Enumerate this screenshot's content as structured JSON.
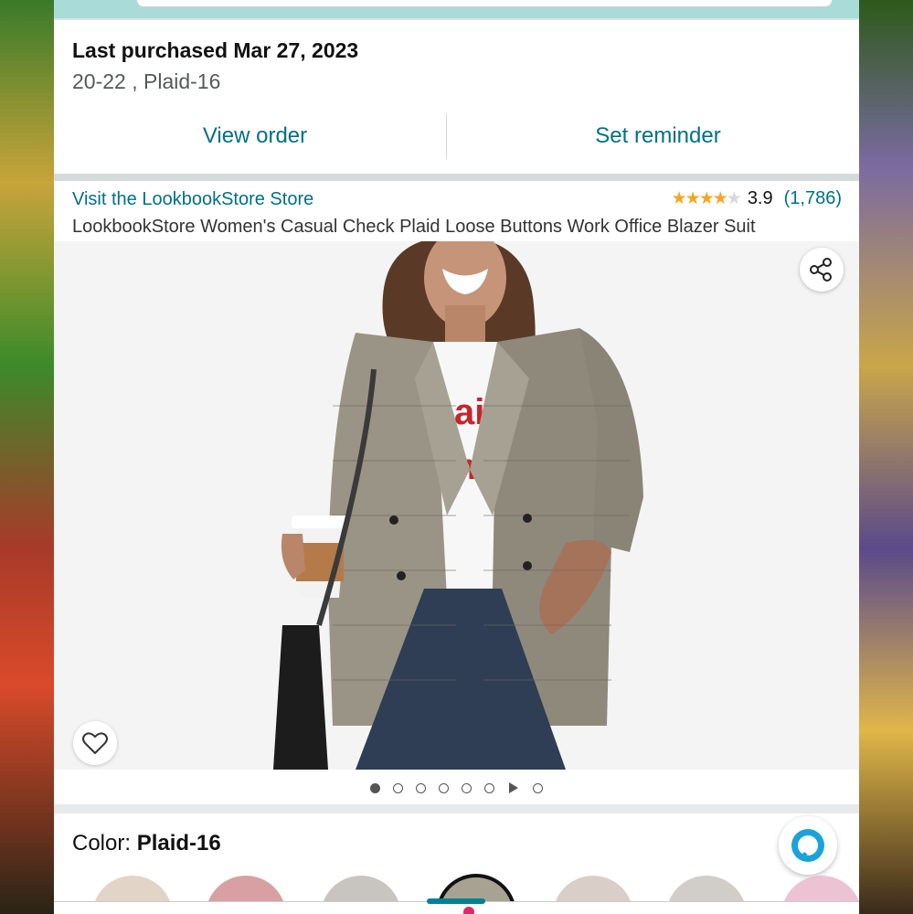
{
  "purchase": {
    "title": "Last purchased Mar 27, 2023",
    "variant": "20-22 , Plaid-16"
  },
  "actions": {
    "view_order": "View order",
    "set_reminder": "Set reminder"
  },
  "store": {
    "link": "Visit the LookbookStore Store"
  },
  "rating": {
    "stars": 3.9,
    "value": "3.9",
    "count": "(1,786)",
    "star_color": "#f5a623"
  },
  "product": {
    "title": "LookbookStore Women's Casual Check Plaid Loose Buttons Work Office Blazer Suit"
  },
  "gallery": {
    "total_dots": 8,
    "active_index": 0,
    "video_index": 6
  },
  "color": {
    "label": "Color: ",
    "value": "Plaid-16"
  },
  "icons": {
    "share": "share-icon",
    "wishlist": "heart-icon",
    "alexa": "alexa-icon",
    "video": "play-icon"
  },
  "colors": {
    "link": "#007185",
    "accent_teal": "#008296",
    "top_strip": "#a9dbd8"
  }
}
